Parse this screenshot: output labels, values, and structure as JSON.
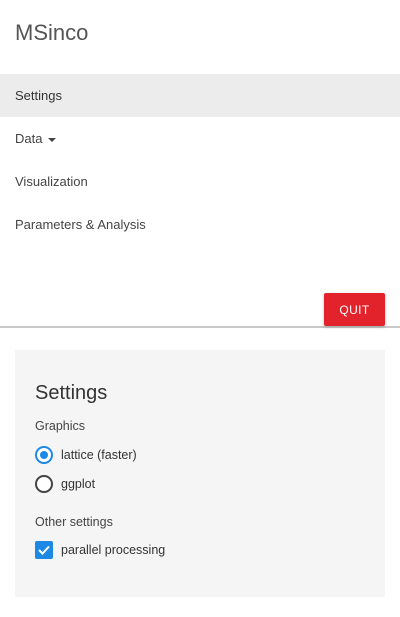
{
  "navbar": {
    "brand": "MSinco",
    "items": [
      {
        "label": "Settings",
        "active": true
      },
      {
        "label": "Data",
        "dropdown": true
      },
      {
        "label": "Visualization"
      },
      {
        "label": "Parameters & Analysis"
      }
    ],
    "quit_label": "QUIT",
    "quit_color": "#e2232b",
    "dropdown_icon": "caret-down-icon"
  },
  "panel": {
    "title": "Settings",
    "graphics": {
      "label": "Graphics",
      "options": [
        {
          "label": "lattice (faster)",
          "selected": true
        },
        {
          "label": "ggplot",
          "selected": false
        }
      ]
    },
    "other": {
      "label": "Other settings",
      "parallel": {
        "label": "parallel processing",
        "checked": true
      }
    },
    "accent_color": "#1e88e5"
  }
}
